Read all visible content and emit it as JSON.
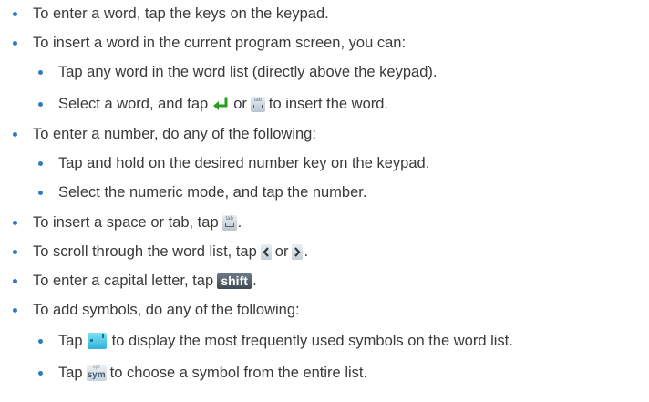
{
  "colors": {
    "bullet": "#2b7bc4",
    "text": "#3a3a3a"
  },
  "icons": {
    "enter": "enter-key-icon",
    "tab": "tab-key-icon",
    "left": "scroll-left-icon",
    "right": "scroll-right-icon",
    "shift": "shift-key-icon",
    "smiley": "smiley-key-icon",
    "sym": "sym-key-icon"
  },
  "keys": {
    "tab_top": "tab",
    "shift_label": "shift",
    "sym_top": "opt",
    "sym_main": "sym"
  },
  "items": {
    "enter_word": "To enter a word, tap the keys on the keypad.",
    "insert_word": "To insert a word in the current program screen, you can:",
    "insert_word_sub1": "Tap any word in the word list (directly above the keypad).",
    "insert_word_sub2_a": "Select a word, and tap",
    "insert_word_sub2_b": "or",
    "insert_word_sub2_c": "to insert the word.",
    "enter_number": "To enter a number, do any of the following:",
    "enter_number_sub1": "Tap and hold on the desired number key on the keypad.",
    "enter_number_sub2": "Select the numeric mode, and tap the number.",
    "space_tab_a": "To insert a space or tab, tap",
    "space_tab_b": ".",
    "scroll_a": "To scroll through the word list, tap",
    "scroll_b": "or",
    "scroll_c": ".",
    "capital_a": "To enter a capital letter, tap",
    "capital_b": ".",
    "symbols": "To add symbols, do any of the following:",
    "symbols_sub1_a": "Tap",
    "symbols_sub1_b": "to display the most frequently used symbols on the word list.",
    "symbols_sub2_a": "Tap",
    "symbols_sub2_b": "to choose a symbol from the entire list."
  }
}
